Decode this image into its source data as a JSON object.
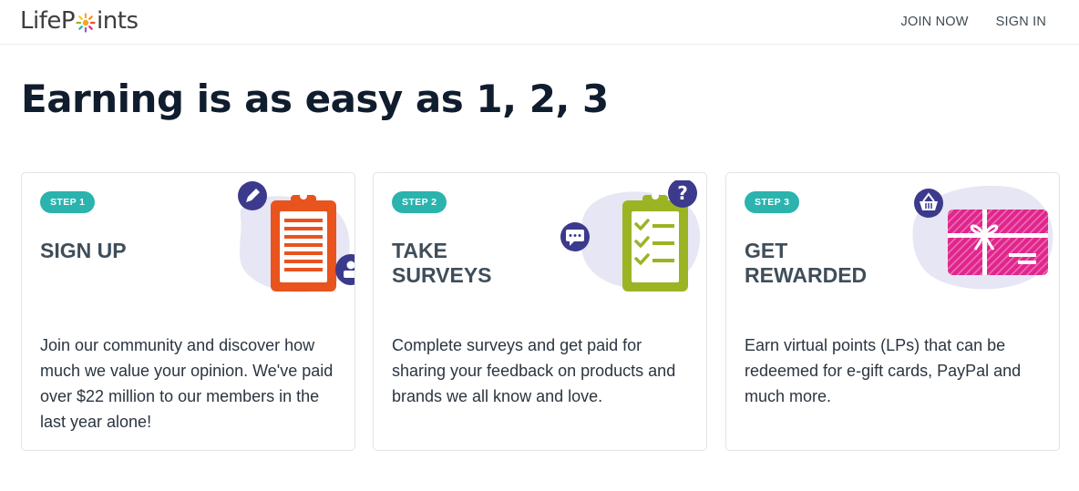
{
  "brand": {
    "logo_before": "LifeP",
    "logo_after": "ints"
  },
  "nav": {
    "join_label": "JOIN NOW",
    "signin_label": "SIGN IN"
  },
  "headline": "Earning is as easy as 1, 2, 3",
  "steps": [
    {
      "badge": "STEP 1",
      "title": "SIGN UP",
      "description": "Join our community and discover how much we value your opinion. We've paid over $22 million to our members in the last year alone!"
    },
    {
      "badge": "STEP 2",
      "title": "TAKE SURVEYS",
      "description": "Complete surveys and get paid for sharing your feedback on products and brands we all know and love."
    },
    {
      "badge": "STEP 3",
      "title": "GET REWARDED",
      "description": "Earn virtual points (LPs) that can be redeemed for e-gift cards, PayPal and much more."
    }
  ],
  "colors": {
    "badge": "#2bb3ad",
    "clipboard_orange": "#e8531e",
    "clipboard_green": "#9ab424",
    "giftcard_pink": "#e0258c",
    "icon_purple": "#3b3a8c",
    "blob": "#e6e6f4"
  },
  "icons": [
    "sun-logo-icon",
    "pencil-icon",
    "user-icon",
    "question-icon",
    "chat-icon",
    "basket-icon"
  ]
}
